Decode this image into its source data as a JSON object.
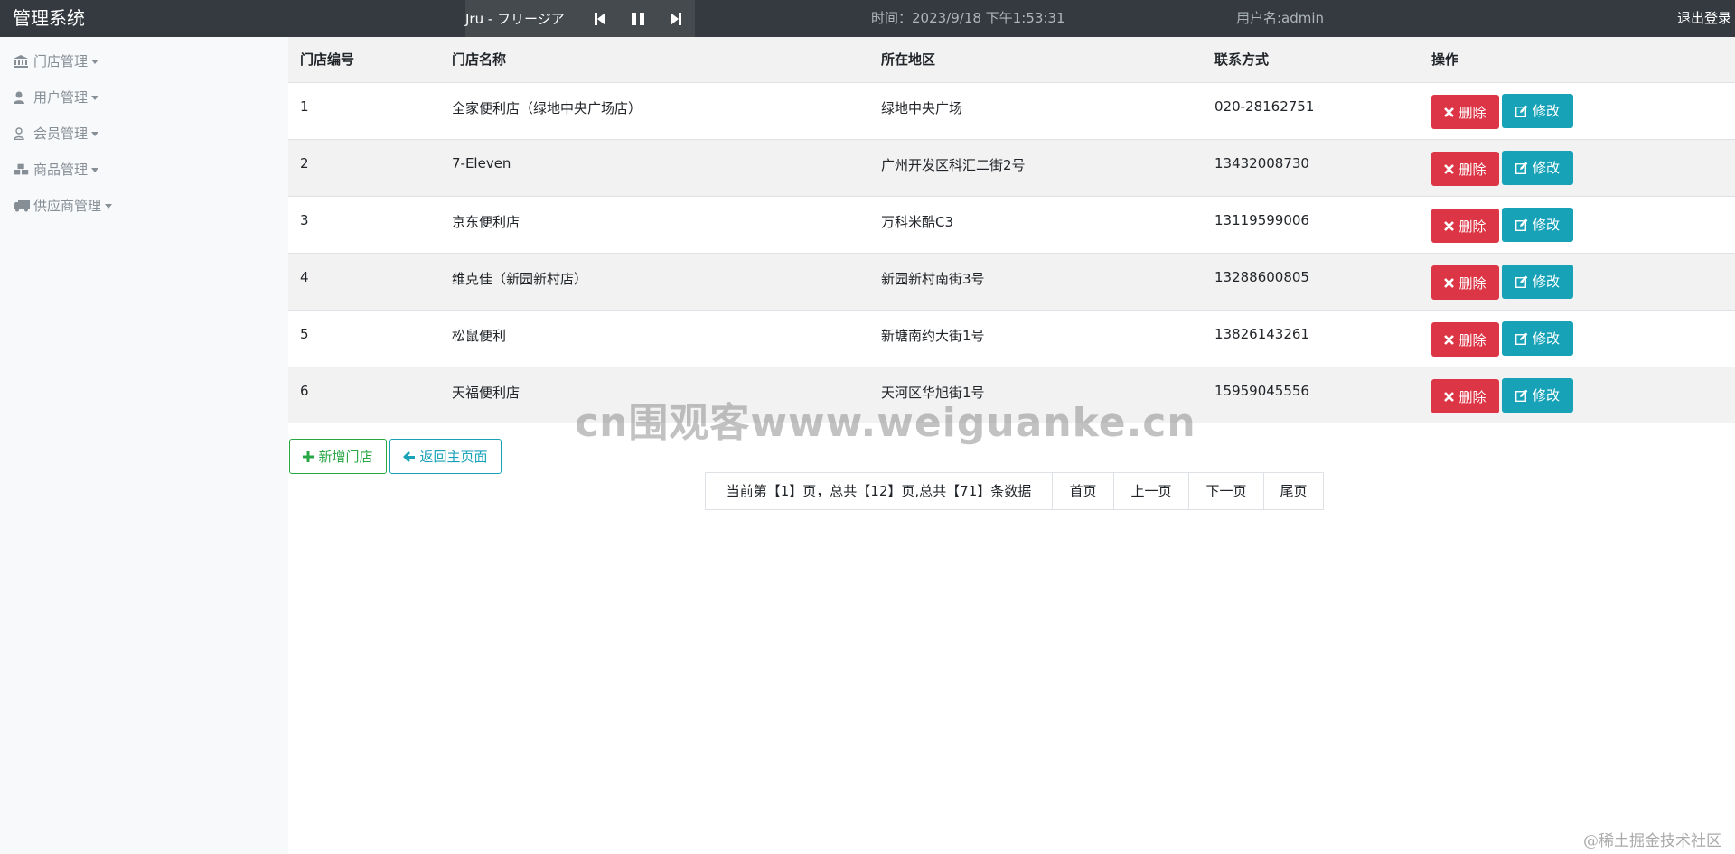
{
  "header": {
    "brand": "管理系统",
    "player": {
      "song": "Jru - フリージア"
    },
    "time": "时间：2023/9/18 下午1:53:31",
    "user": "用户名:admin",
    "logout": "退出登录"
  },
  "sidebar": {
    "items": [
      {
        "label": "门店管理",
        "icon": "bank-icon"
      },
      {
        "label": "用户管理",
        "icon": "user-icon"
      },
      {
        "label": "会员管理",
        "icon": "user-outline-icon"
      },
      {
        "label": "商品管理",
        "icon": "cubes-icon"
      },
      {
        "label": "供应商管理",
        "icon": "truck-icon"
      }
    ]
  },
  "table": {
    "headers": [
      "门店编号",
      "门店名称",
      "所在地区",
      "联系方式",
      "操作"
    ],
    "rows": [
      {
        "id": "1",
        "name": "全家便利店（绿地中央广场店）",
        "region": "绿地中央广场",
        "contact": "020-28162751"
      },
      {
        "id": "2",
        "name": "7-Eleven",
        "region": "广州开发区科汇二街2号",
        "contact": "13432008730"
      },
      {
        "id": "3",
        "name": "京东便利店",
        "region": "万科米酷C3",
        "contact": "13119599006"
      },
      {
        "id": "4",
        "name": "维克佳（新园新村店）",
        "region": "新园新村南街3号",
        "contact": "13288600805"
      },
      {
        "id": "5",
        "name": "松鼠便利",
        "region": "新塘南约大街1号",
        "contact": "13826143261"
      },
      {
        "id": "6",
        "name": "天福便利店",
        "region": "天河区华旭街1号",
        "contact": "15959045556"
      }
    ],
    "delete_label": "删除",
    "edit_label": "修改"
  },
  "actions": {
    "add_store": "新增门店",
    "back_home": "返回主页面"
  },
  "pagination": {
    "info": "当前第【1】页，总共【12】页,总共【71】条数据",
    "first": "首页",
    "prev": "上一页",
    "next": "下一页",
    "last": "尾页"
  },
  "watermark": "cn围观客www.weiguanke.cn",
  "footer_mark": "@稀土掘金技术社区",
  "colors": {
    "danger": "#dc3545",
    "info": "#17a2b8",
    "success": "#28a745",
    "topbar": "#343a40"
  }
}
